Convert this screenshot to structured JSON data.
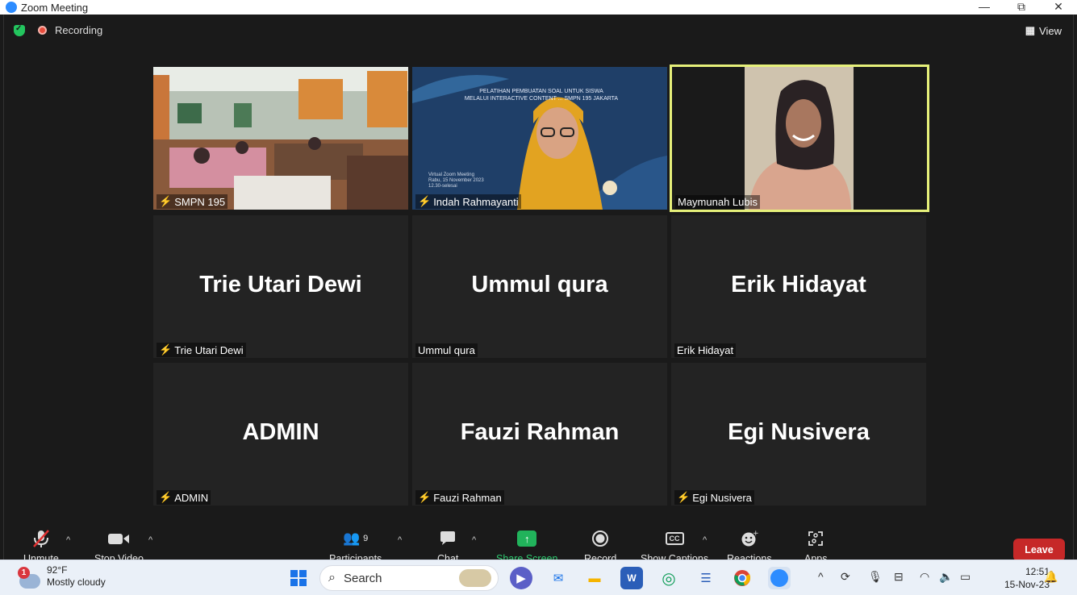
{
  "window": {
    "title": "Zoom Meeting",
    "controls": [
      "—",
      "⧉",
      "✕"
    ]
  },
  "status": {
    "recording_label": "Recording",
    "view_label": "View"
  },
  "tiles": [
    {
      "name": "SMPN 195",
      "big": "",
      "muted": true,
      "type": "classroom"
    },
    {
      "name": "Indah Rahmayanti",
      "big": "",
      "muted": true,
      "type": "presenter",
      "slide_line1": "PELATIHAN PEMBUATAN SOAL UNTUK SISWA",
      "slide_line2": "MELALUI INTERACTIVE CONTENT ... SMPN 195 JAKARTA",
      "slide_meta1": "Virtual Zoom Meeting",
      "slide_meta2": "Rabu, 15 November 2023",
      "slide_meta3": "12.30-selesai"
    },
    {
      "name": "Maymunah Lubis",
      "big": "",
      "muted": false,
      "type": "speaker"
    },
    {
      "name": "Trie Utari Dewi",
      "big": "Trie Utari Dewi",
      "muted": true
    },
    {
      "name": "Ummul qura",
      "big": "Ummul qura",
      "muted": false
    },
    {
      "name": "Erik Hidayat",
      "big": "Erik Hidayat",
      "muted": false
    },
    {
      "name": "ADMIN",
      "big": "ADMIN",
      "muted": true
    },
    {
      "name": "Fauzi Rahman",
      "big": "Fauzi Rahman",
      "muted": true
    },
    {
      "name": "Egi Nusivera",
      "big": "Egi Nusivera",
      "muted": true
    }
  ],
  "toolbar": {
    "unmute": "Unmute",
    "stop_video": "Stop Video",
    "participants": "Participants",
    "participants_count": "9",
    "chat": "Chat",
    "share_screen": "Share Screen",
    "record": "Record",
    "show_captions": "Show Captions",
    "captions_icon": "CC",
    "reactions": "Reactions",
    "apps": "Apps",
    "leave": "Leave"
  },
  "taskbar": {
    "weather_temp": "92°F",
    "weather_desc": "Mostly cloudy",
    "weather_badge": "1",
    "search_label": "Search",
    "time": "12:51",
    "date": "15-Nov-23"
  },
  "colors": {
    "accent_green": "#21b35b",
    "active_speaker_border": "#e6f07a",
    "leave_red": "#c62828",
    "mute_red": "#e03131"
  }
}
